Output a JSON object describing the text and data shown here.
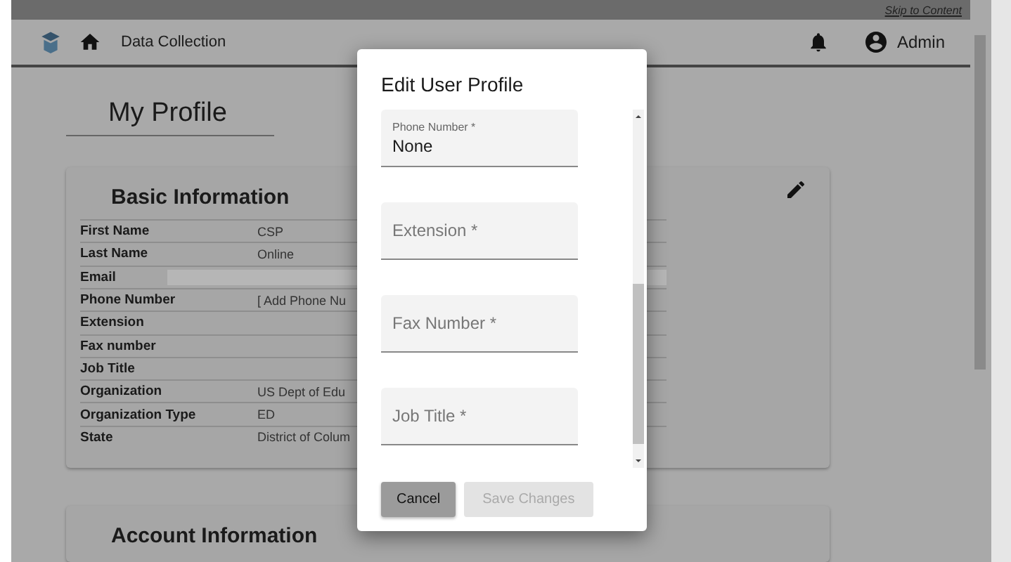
{
  "skip_link": "Skip to Content",
  "header": {
    "title": "Data Collection",
    "user": "Admin"
  },
  "page_title": "My Profile",
  "basic_info": {
    "title": "Basic Information",
    "rows": [
      {
        "label": "First Name",
        "value": "CSP"
      },
      {
        "label": "Last Name",
        "value": "Online"
      },
      {
        "label": "Email",
        "redacted": true
      },
      {
        "label": "Phone Number",
        "value": "[ Add Phone Nu"
      },
      {
        "label": "Extension"
      },
      {
        "label": "Fax number"
      },
      {
        "label": "Job Title"
      },
      {
        "label": "Organization",
        "value": "US Dept of Edu"
      },
      {
        "label": "Organization Type",
        "value": "ED"
      },
      {
        "label": "State",
        "value": "District of Colum"
      }
    ]
  },
  "account_info": {
    "title": "Account Information"
  },
  "dialog": {
    "title": "Edit User Profile",
    "fields": [
      {
        "placeholder": "Phone Number *",
        "value": "None"
      },
      {
        "placeholder": "Extension *"
      },
      {
        "placeholder": "Fax Number *"
      },
      {
        "placeholder": "Job Title *"
      }
    ],
    "buttons": [
      {
        "label": "Cancel",
        "disabled": false
      },
      {
        "label": "Save Changes",
        "disabled": true
      }
    ]
  }
}
